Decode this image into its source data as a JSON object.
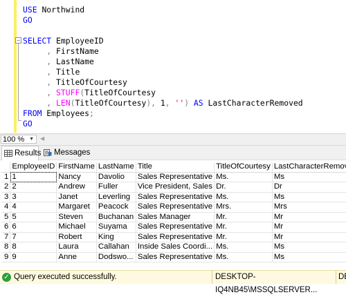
{
  "editor": {
    "code_lines": [
      [
        {
          "t": "USE ",
          "c": "kw"
        },
        {
          "t": "Northwind",
          "c": "id"
        }
      ],
      [
        {
          "t": "GO",
          "c": "kw"
        }
      ],
      [],
      [
        {
          "t": "SELECT ",
          "c": "kw"
        },
        {
          "t": "EmployeeID",
          "c": "id"
        }
      ],
      [
        {
          "t": "     , ",
          "c": "op"
        },
        {
          "t": "FirstName",
          "c": "id"
        }
      ],
      [
        {
          "t": "     , ",
          "c": "op"
        },
        {
          "t": "LastName",
          "c": "id"
        }
      ],
      [
        {
          "t": "     , ",
          "c": "op"
        },
        {
          "t": "Title",
          "c": "id"
        }
      ],
      [
        {
          "t": "     , ",
          "c": "op"
        },
        {
          "t": "TitleOfCourtesy",
          "c": "id"
        }
      ],
      [
        {
          "t": "     , ",
          "c": "op"
        },
        {
          "t": "STUFF",
          "c": "fn"
        },
        {
          "t": "(",
          "c": "op"
        },
        {
          "t": "TitleOfCourtesy",
          "c": "id"
        }
      ],
      [
        {
          "t": "     , ",
          "c": "op"
        },
        {
          "t": "LEN",
          "c": "fn"
        },
        {
          "t": "(",
          "c": "op"
        },
        {
          "t": "TitleOfCourtesy",
          "c": "id"
        },
        {
          "t": "), ",
          "c": "op"
        },
        {
          "t": "1",
          "c": "id"
        },
        {
          "t": ", ",
          "c": "op"
        },
        {
          "t": "''",
          "c": "str"
        },
        {
          "t": ") ",
          "c": "op"
        },
        {
          "t": "AS ",
          "c": "kw"
        },
        {
          "t": "LastCharacterRemoved",
          "c": "id"
        }
      ],
      [
        {
          "t": "FROM ",
          "c": "kw"
        },
        {
          "t": "Employees",
          "c": "id"
        },
        {
          "t": ";",
          "c": "op"
        }
      ],
      [
        {
          "t": "GO",
          "c": "kw"
        }
      ]
    ],
    "fold_symbol": "−"
  },
  "zoom": {
    "value": "100 %",
    "caret": "▼",
    "scroll_left_arrow": "◀"
  },
  "tabs": {
    "results_label": "Results",
    "messages_label": "Messages"
  },
  "grid": {
    "columns": [
      "EmployeeID",
      "FirstName",
      "LastName",
      "Title",
      "TitleOfCourtesy",
      "LastCharacterRemoved"
    ],
    "rows": [
      [
        "1",
        "1",
        "Nancy",
        "Davolio",
        "Sales Representative",
        "Ms.",
        "Ms"
      ],
      [
        "2",
        "2",
        "Andrew",
        "Fuller",
        "Vice President, Sales",
        "Dr.",
        "Dr"
      ],
      [
        "3",
        "3",
        "Janet",
        "Leverling",
        "Sales Representative",
        "Ms.",
        "Ms"
      ],
      [
        "4",
        "4",
        "Margaret",
        "Peacock",
        "Sales Representative",
        "Mrs.",
        "Mrs"
      ],
      [
        "5",
        "5",
        "Steven",
        "Buchanan",
        "Sales Manager",
        "Mr.",
        "Mr"
      ],
      [
        "6",
        "6",
        "Michael",
        "Suyama",
        "Sales Representative",
        "Mr.",
        "Mr"
      ],
      [
        "7",
        "7",
        "Robert",
        "King",
        "Sales Representative",
        "Mr.",
        "Mr"
      ],
      [
        "8",
        "8",
        "Laura",
        "Callahan",
        "Inside Sales Coordi...",
        "Ms.",
        "Ms"
      ],
      [
        "9",
        "9",
        "Anne",
        "Dodswo...",
        "Sales Representative",
        "Ms.",
        "Ms"
      ]
    ]
  },
  "status": {
    "message": "Query executed successfully.",
    "server": "DESKTOP-IQ4NB45\\MSSQLSERVER...",
    "db_fragment": "DE",
    "ok_glyph": "✓"
  },
  "colors": {
    "keyword": "#0000ff",
    "function": "#ff00ff",
    "string": "#ff0000",
    "operator": "#808080",
    "status_bg": "#fffadf",
    "status_ok": "#2e9e3a",
    "change_bar": "#ffee62"
  }
}
